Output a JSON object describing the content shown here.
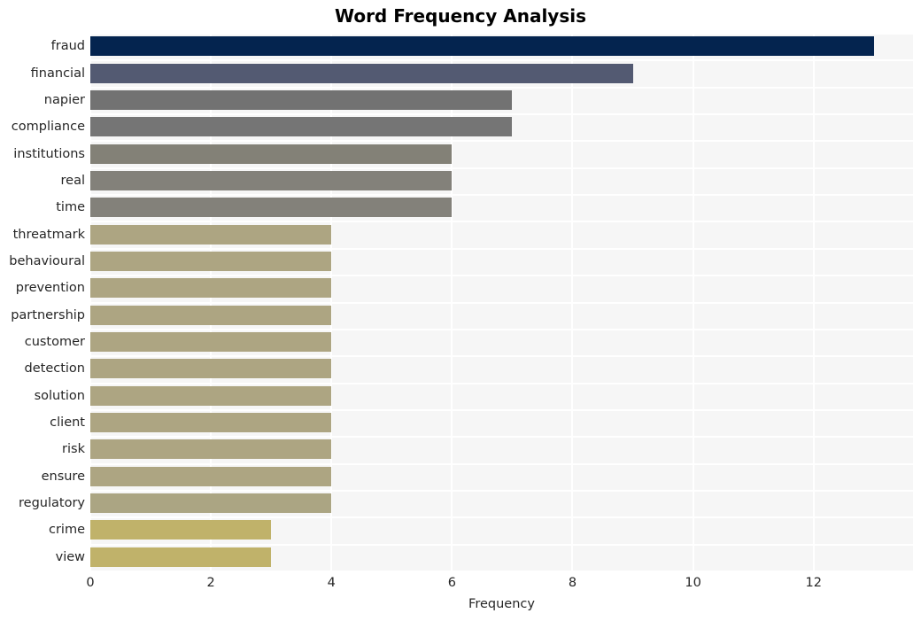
{
  "chart_data": {
    "type": "bar",
    "orientation": "horizontal",
    "title": "Word Frequency Analysis",
    "xlabel": "Frequency",
    "ylabel": "",
    "categories": [
      "fraud",
      "financial",
      "napier",
      "compliance",
      "institutions",
      "real",
      "time",
      "threatmark",
      "behavioural",
      "prevention",
      "partnership",
      "customer",
      "detection",
      "solution",
      "client",
      "risk",
      "ensure",
      "regulatory",
      "crime",
      "view"
    ],
    "values": [
      13,
      9,
      7,
      7,
      6,
      6,
      6,
      4,
      4,
      4,
      4,
      4,
      4,
      4,
      4,
      4,
      4,
      4,
      3,
      3
    ],
    "bar_colors": [
      "#04244f",
      "#535a72",
      "#727272",
      "#757575",
      "#838177",
      "#83817a",
      "#83817a",
      "#ada582",
      "#ada582",
      "#ada582",
      "#ada582",
      "#ada582",
      "#ada582",
      "#ada582",
      "#ada582",
      "#ada582",
      "#ada582",
      "#aba583",
      "#c0b26a",
      "#c0b26a"
    ],
    "xlim": [
      0,
      13.65
    ],
    "xticks": [
      0,
      2,
      4,
      6,
      8,
      10,
      12
    ],
    "xtick_labels": [
      "0",
      "2",
      "4",
      "6",
      "8",
      "10",
      "12"
    ],
    "grid": true,
    "grid_color": "#ffffff",
    "plot_background": "#f6f6f6",
    "legend": null,
    "title_color": "#000000",
    "tick_color": "#262626"
  }
}
